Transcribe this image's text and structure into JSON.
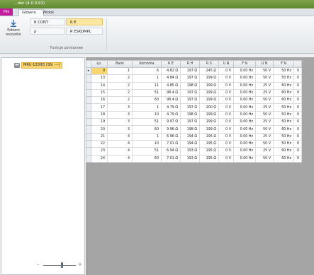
{
  "window": {
    "title": "...der (4.0.0.63)"
  },
  "ribbon_tabs": {
    "file": "Plik",
    "tabs": [
      "Główne",
      "Widok"
    ]
  },
  "ribbon": {
    "refresh_label_1": "Pobierz",
    "refresh_label_2": "wszystko",
    "options": [
      "R CONT",
      "R E",
      "ρ",
      "R ESKOMPL"
    ],
    "group_label": "Funkcje pomiarowe"
  },
  "tree": {
    "device": "MRU-120HD (SN: ---)"
  },
  "grid": {
    "columns": [
      "Lp.",
      "Bank",
      "Komórka",
      "R E",
      "R H",
      "R S",
      "U N",
      "F N",
      "U N",
      "F N"
    ],
    "rows": [
      [
        "9",
        "1",
        "6",
        "4.82 Ω",
        "197 Ω",
        "245 Ω",
        "0 V",
        "0.00 Hz",
        "50 V",
        "50 Hz"
      ],
      [
        "13",
        "2",
        "1",
        "4.84 Ω",
        "197 Ω",
        "199 Ω",
        "0 V",
        "0.00 Hz",
        "50 V",
        "50 Hz"
      ],
      [
        "14",
        "2",
        "11",
        "4.85 Ω",
        "198 Ω",
        "199 Ω",
        "0 V",
        "0.00 Hz",
        "25 V",
        "60 Hz"
      ],
      [
        "15",
        "2",
        "51",
        "98.4 Ω",
        "197 Ω",
        "199 Ω",
        "0 V",
        "0.00 Hz",
        "25 V",
        "60 Hz"
      ],
      [
        "16",
        "2",
        "60",
        "98.4 Ω",
        "197 Ω",
        "199 Ω",
        "0 V",
        "0.00 Hz",
        "50 V",
        "60 Hz"
      ],
      [
        "17",
        "3",
        "1",
        "4.79 Ω",
        "197 Ω",
        "200 Ω",
        "0 V",
        "0.00 Hz",
        "25 V",
        "50 Hz"
      ],
      [
        "18",
        "3",
        "10",
        "4.79 Ω",
        "198 Ω",
        "199 Ω",
        "0 V",
        "0.00 Hz",
        "50 V",
        "50 Hz"
      ],
      [
        "19",
        "3",
        "51",
        "9.97 Ω",
        "197 Ω",
        "199 Ω",
        "0 V",
        "0.00 Hz",
        "25 V",
        "50 Hz"
      ],
      [
        "20",
        "3",
        "60",
        "9.96 Ω",
        "198 Ω",
        "199 Ω",
        "0 V",
        "0.00 Hz",
        "50 V",
        "60 Hz"
      ],
      [
        "21",
        "4",
        "1",
        "6.96 Ω",
        "194 Ω",
        "195 Ω",
        "0 V",
        "0.00 Hz",
        "25 V",
        "50 Hz"
      ],
      [
        "22",
        "4",
        "10",
        "7.01 Ω",
        "194 Ω",
        "195 Ω",
        "0 V",
        "0.00 Hz",
        "50 V",
        "50 Hz"
      ],
      [
        "23",
        "4",
        "51",
        "6.94 Ω",
        "193 Ω",
        "195 Ω",
        "0 V",
        "0.00 Hz",
        "25 V",
        "60 Hz"
      ],
      [
        "24",
        "4",
        "60",
        "7.01 Ω",
        "193 Ω",
        "195 Ω",
        "0 V",
        "0.00 Hz",
        "50 V",
        "60 Hz"
      ]
    ],
    "extra_col_value": "0"
  },
  "colors": {
    "title_bar": "#6e9a3c",
    "file_tab": "#c21d9e",
    "selection": "#f9d56f",
    "grid_background": "#a5a5a5"
  }
}
